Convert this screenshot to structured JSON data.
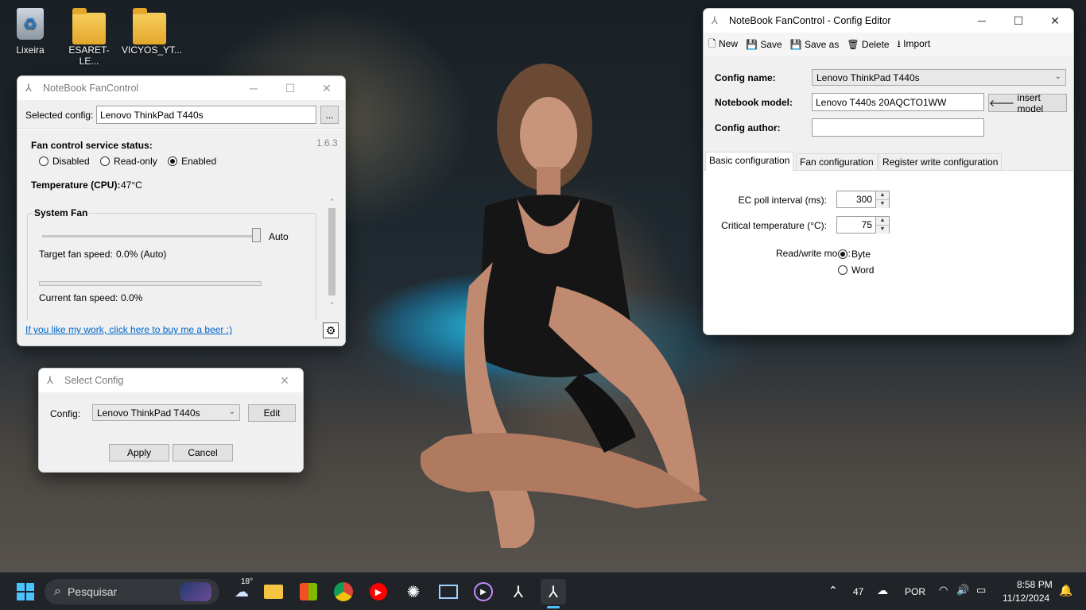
{
  "desktop": {
    "icons": [
      {
        "label": "Lixeira",
        "icon": "recycle-bin-icon"
      },
      {
        "label": "ESARET-LE...",
        "icon": "folder-icon"
      },
      {
        "label": "VICYOS_YT...",
        "icon": "folder-icon"
      }
    ]
  },
  "main_window": {
    "title": "NoteBook FanControl",
    "selected_config_label": "Selected config:",
    "selected_config_value": "Lenovo ThinkPad T440s",
    "browse_label": "...",
    "version": "1.6.3",
    "service_status_label": "Fan control service status:",
    "status_options": [
      "Disabled",
      "Read-only",
      "Enabled"
    ],
    "status_selected": "Enabled",
    "temperature_label": "Temperature (CPU):",
    "temperature_value": "47°C",
    "fan_group_label": "System Fan",
    "slider_auto_label": "Auto",
    "target_speed_label": "Target fan speed:",
    "target_speed_value": "0.0% (Auto)",
    "current_speed_label": "Current fan speed:",
    "current_speed_value": "0.0%",
    "donate_link": "If you like my work, click here to buy me a beer :)"
  },
  "select_config": {
    "title": "Select Config",
    "config_label": "Config:",
    "config_value": "Lenovo ThinkPad T440s",
    "edit_label": "Edit",
    "apply_label": "Apply",
    "cancel_label": "Cancel"
  },
  "config_editor": {
    "title": "NoteBook FanControl - Config Editor",
    "toolbar": {
      "new": "New",
      "save": "Save",
      "save_as": "Save as",
      "delete": "Delete",
      "import": "Import"
    },
    "config_name_label": "Config name:",
    "config_name_value": "Lenovo ThinkPad T440s",
    "notebook_model_label": "Notebook model:",
    "notebook_model_value": "Lenovo T440s 20AQCTO1WW",
    "insert_model_label": "insert model",
    "config_author_label": "Config author:",
    "config_author_value": "",
    "tabs": [
      "Basic configuration",
      "Fan configuration",
      "Register write configuration"
    ],
    "active_tab": "Basic configuration",
    "ec_poll_label": "EC poll interval (ms):",
    "ec_poll_value": "300",
    "critical_temp_label": "Critical temperature (°C):",
    "critical_temp_value": "75",
    "rw_mode_label": "Read/write mode:",
    "rw_options": [
      "Byte",
      "Word"
    ],
    "rw_selected": "Byte"
  },
  "taskbar": {
    "search_placeholder": "Pesquisar",
    "weather_temp": "18°",
    "tray_count": "47",
    "language": "POR",
    "time": "8:58 PM",
    "date": "11/12/2024"
  },
  "colors": {
    "link": "#0066cc",
    "taskbar": "#202428",
    "accent": "#0078d4"
  }
}
